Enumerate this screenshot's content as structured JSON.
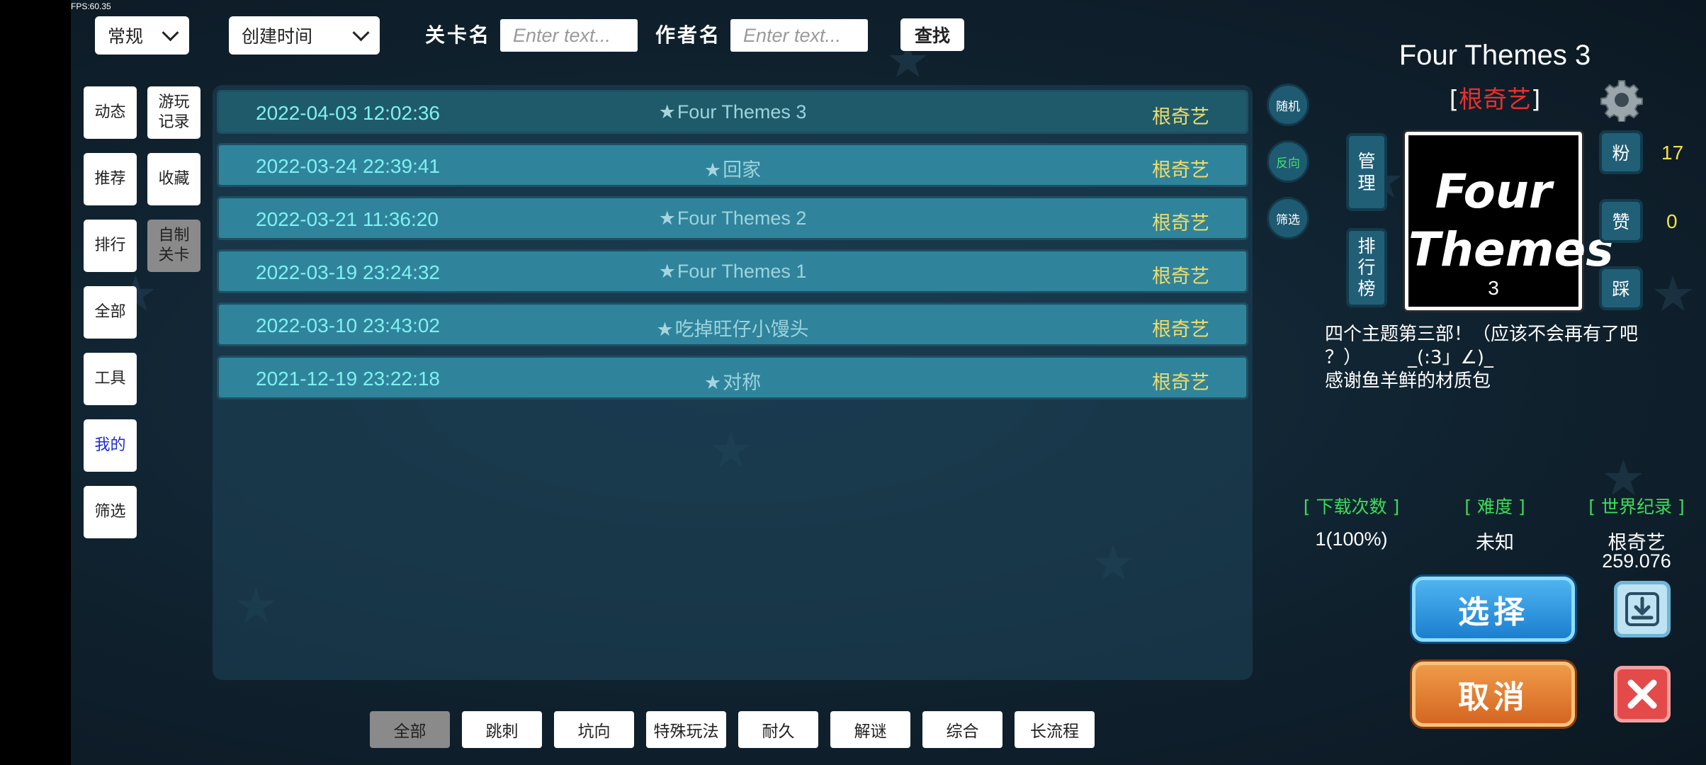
{
  "fps": "FPS:60.35",
  "top": {
    "mode": "常规",
    "sort": "创建时间",
    "level_label": "关卡名",
    "level_placeholder": "Enter text...",
    "author_label": "作者名",
    "author_placeholder": "Enter text...",
    "search": "查找"
  },
  "left_nav": {
    "dongtai": "动态",
    "youwan": "游玩\n记录",
    "tuijian": "推荐",
    "shoucang": "收藏",
    "paihang": "排行",
    "zizhi": "自制\n关卡",
    "quanbu": "全部",
    "gongju": "工具",
    "wode": "我的",
    "shaixuan": "筛选"
  },
  "levels": [
    {
      "date": "2022-04-03 12:02:36",
      "name": "Four Themes  3",
      "author": "根奇艺"
    },
    {
      "date": "2022-03-24 22:39:41",
      "name": "回家",
      "author": "根奇艺"
    },
    {
      "date": "2022-03-21 11:36:20",
      "name": "Four Themes  2",
      "author": "根奇艺"
    },
    {
      "date": "2022-03-19 23:24:32",
      "name": "Four  Themes  1",
      "author": "根奇艺"
    },
    {
      "date": "2022-03-10 23:43:02",
      "name": "吃掉旺仔小馒头",
      "author": "根奇艺"
    },
    {
      "date": "2021-12-19 23:22:18",
      "name": "对称",
      "author": "根奇艺"
    }
  ],
  "side_circles": {
    "random": "随机",
    "reverse": "反向",
    "filter": "筛选"
  },
  "tags": [
    "全部",
    "跳刺",
    "坑向",
    "特殊玩法",
    "耐久",
    "解谜",
    "综合",
    "长流程"
  ],
  "detail": {
    "title": "Four Themes  3",
    "author": "根奇艺",
    "manage": "管\n理",
    "leaderboard": "排\n行\n榜",
    "thumb_line1": "Four",
    "thumb_line2": "Themes",
    "thumb_line3": "3",
    "fans_label": "粉",
    "fans": "17",
    "likes_label": "赞",
    "likes": "0",
    "dislike_label": "踩",
    "description": "四个主题第三部！（应该不会再有了吧\n？）　　　_(:3」∠)_\n感谢鱼羊鲜的材质包",
    "downloads_h": "[ 下载次数 ]",
    "downloads": "1(100%)",
    "difficulty_h": "[ 难度 ]",
    "difficulty": "未知",
    "record_h": "[ 世界纪录 ]",
    "record_holder": "根奇艺",
    "record_time": "259.076",
    "select": "选择",
    "cancel": "取消"
  },
  "colors": {
    "row": "#2f849c",
    "row_active": "#1f5a6b",
    "date": "#7ff0f0",
    "author": "#f1dc6a",
    "stat_header": "#3ddc5a"
  }
}
